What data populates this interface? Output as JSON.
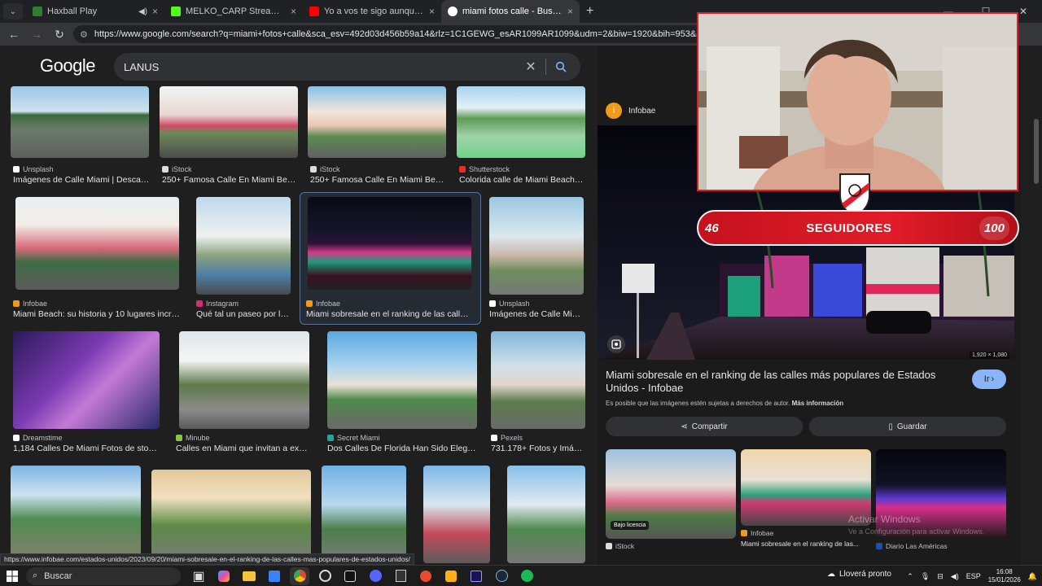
{
  "tabs": [
    {
      "title": "Haxball Play",
      "color": "#2e7d32"
    },
    {
      "title": "MELKO_CARP Stream - Watch Live",
      "color": "#53fc18"
    },
    {
      "title": "Yo a vos te sigo aunque vos vayas a...",
      "color": "#ff0000"
    },
    {
      "title": "miami fotos calle - Buscar con Google",
      "color": "#4285f4"
    }
  ],
  "url": "https://www.google.com/search?q=miami+fotos+calle&sca_esv=492d03d456b59a14&rlz=1C1GEWG_esAR1099AR1099&udm=2&biw=1920&bih=953&aic=0&sxsrf=ANbL-n7Ifr1DNy",
  "google_logo": "Google",
  "search_query": "LANUS",
  "results": [
    {
      "source": "Unsplash",
      "caption": "Imágenes de Calle Miami | Descarga...",
      "src_color": "#ffffff"
    },
    {
      "source": "iStock",
      "caption": "250+ Famosa Calle En Miami Beach...",
      "src_color": "#ffffff"
    },
    {
      "source": "iStock",
      "caption": "250+ Famosa Calle En Miami Beach...",
      "src_color": "#ffffff"
    },
    {
      "source": "Shutterstock",
      "caption": "Colorida calle de Miami Beach O...",
      "src_color": "#ee2b24"
    },
    {
      "source": "Infobae",
      "caption": "Miami Beach: su historia y 10 lugares increíbl...",
      "src_color": "#f09a1a"
    },
    {
      "source": "Instagram",
      "caption": "Qué tal un paseo por la ...",
      "src_color": "#d62976"
    },
    {
      "source": "Infobae",
      "caption": "Miami sobresale en el ranking de las calles m...",
      "src_color": "#f09a1a"
    },
    {
      "source": "Unsplash",
      "caption": "Imágenes de Calle Miam...",
      "src_color": "#ffffff"
    },
    {
      "source": "Dreamstime",
      "caption": "1,184 Calles De Miami Fotos de stock - ...",
      "src_color": "#ffffff"
    },
    {
      "source": "Minube",
      "caption": "Calles en Miami que invitan a explor...",
      "src_color": "#8bc34a"
    },
    {
      "source": "Secret Miami",
      "caption": "Dos Calles De Florida Han Sido Elegidas...",
      "src_color": "#26a69a"
    },
    {
      "source": "Pexels",
      "caption": "731.178+ Fotos y Imág...",
      "src_color": "#ffffff"
    }
  ],
  "panel": {
    "source": "Infobae",
    "resolution": "1,920 × 1,080",
    "title": "Miami sobresale en el ranking de las calles más populares de Estados Unidos - Infobae",
    "go_label": "Ir",
    "note": "Es posible que las imágenes estén sujetas a derechos de autor.",
    "note_link": "Más información",
    "share_label": "Compartir",
    "save_label": "Guardar",
    "related": [
      {
        "badge": "Bajo licencia",
        "source": "iStock",
        "caption": ""
      },
      {
        "badge": "",
        "source": "Infobae",
        "caption": "Miami sobresale en el ranking de las..."
      },
      {
        "badge": "",
        "source": "Diario Las Américas",
        "caption": ""
      }
    ]
  },
  "status_url": "https://www.infobae.com/estados-unidos/2023/09/20/miami-sobresale-en-el-ranking-de-las-calles-mas-populares-de-estados-unidos/",
  "overlay": {
    "followers_current": "46",
    "followers_label": "SEGUIDORES",
    "followers_goal": "100"
  },
  "watermark": {
    "line1": "Activar Windows",
    "line2": "Ve a Configuración para activar Windows."
  },
  "taskbar": {
    "search_label": "Buscar",
    "weather": "Lloverá pronto",
    "lang": "ESP",
    "time": "16:08",
    "date": "15/01/2026"
  }
}
